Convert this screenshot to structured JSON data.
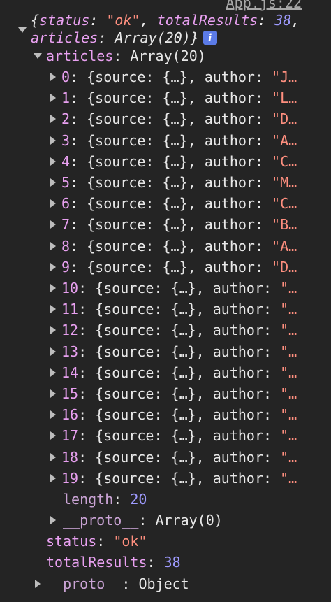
{
  "source_link": "App.js:22",
  "summary": {
    "line1": {
      "open": "{",
      "status_key": "status",
      "colon": ": ",
      "status_value": "\"ok\"",
      "comma": ", ",
      "total_key": "totalResults",
      "total_value": "38",
      "trail": ","
    },
    "line2": {
      "key": "articles",
      "colon": ": ",
      "value": "Array(20)",
      "close": "}"
    },
    "info_icon": "i"
  },
  "articles": {
    "key": "articles",
    "colon": ": ",
    "value": "Array(20)",
    "items": [
      {
        "index": "0",
        "preview": ": {source: {…}, author: ",
        "author": "\"J…"
      },
      {
        "index": "1",
        "preview": ": {source: {…}, author: ",
        "author": "\"L…"
      },
      {
        "index": "2",
        "preview": ": {source: {…}, author: ",
        "author": "\"D…"
      },
      {
        "index": "3",
        "preview": ": {source: {…}, author: ",
        "author": "\"A…"
      },
      {
        "index": "4",
        "preview": ": {source: {…}, author: ",
        "author": "\"C…"
      },
      {
        "index": "5",
        "preview": ": {source: {…}, author: ",
        "author": "\"M…"
      },
      {
        "index": "6",
        "preview": ": {source: {…}, author: ",
        "author": "\"C…"
      },
      {
        "index": "7",
        "preview": ": {source: {…}, author: ",
        "author": "\"B…"
      },
      {
        "index": "8",
        "preview": ": {source: {…}, author: ",
        "author": "\"A…"
      },
      {
        "index": "9",
        "preview": ": {source: {…}, author: ",
        "author": "\"D…"
      },
      {
        "index": "10",
        "preview": ": {source: {…}, author: ",
        "author": "\"…"
      },
      {
        "index": "11",
        "preview": ": {source: {…}, author: ",
        "author": "\"…"
      },
      {
        "index": "12",
        "preview": ": {source: {…}, author: ",
        "author": "\"…"
      },
      {
        "index": "13",
        "preview": ": {source: {…}, author: ",
        "author": "\"…"
      },
      {
        "index": "14",
        "preview": ": {source: {…}, author: ",
        "author": "\"…"
      },
      {
        "index": "15",
        "preview": ": {source: {…}, author: ",
        "author": "\"…"
      },
      {
        "index": "16",
        "preview": ": {source: {…}, author: ",
        "author": "\"…"
      },
      {
        "index": "17",
        "preview": ": {source: {…}, author: ",
        "author": "\"…"
      },
      {
        "index": "18",
        "preview": ": {source: {…}, author: ",
        "author": "\"…"
      },
      {
        "index": "19",
        "preview": ": {source: {…}, author: ",
        "author": "\"…"
      }
    ],
    "length_key": "length",
    "length_value": "20",
    "proto_key": "__proto__",
    "proto_value": "Array(0)"
  },
  "status": {
    "key": "status",
    "value": "\"ok\""
  },
  "total_results": {
    "key": "totalResults",
    "value": "38"
  },
  "proto": {
    "key": "__proto__",
    "value": "Object"
  },
  "colors": {
    "background": "#242424",
    "property": "#e8a0f0",
    "string": "#ff8f7f",
    "number": "#9f9bff",
    "text": "#e8e8e8"
  }
}
